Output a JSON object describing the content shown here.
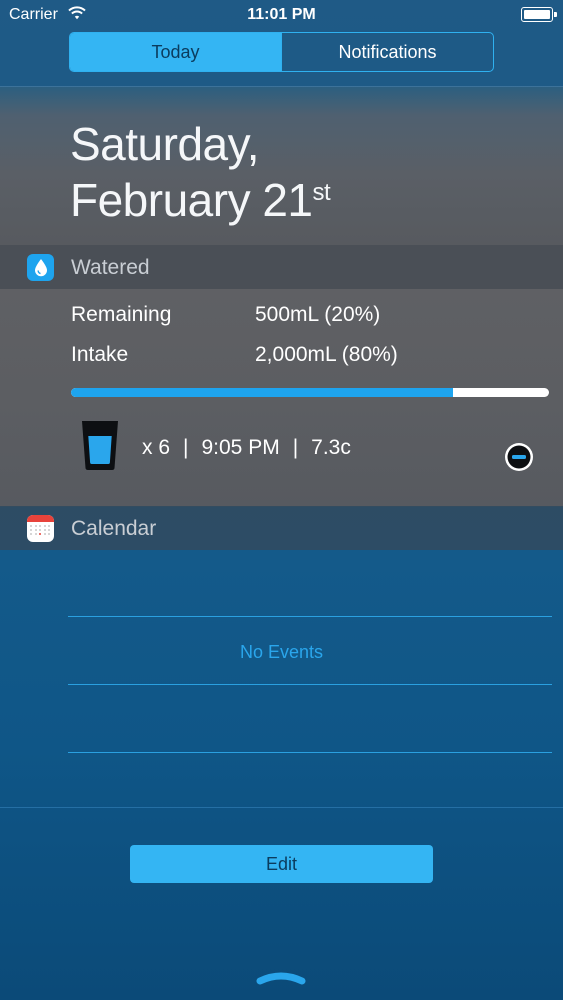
{
  "status_bar": {
    "carrier": "Carrier",
    "time": "11:01 PM",
    "wifi_icon": "wifi-icon",
    "battery_level": 1.0
  },
  "segmented_control": {
    "today_label": "Today",
    "notifications_label": "Notifications",
    "selected": "Today"
  },
  "date": {
    "line1": "Saturday,",
    "line2": "February 21",
    "suffix": "st"
  },
  "watered_widget": {
    "title": "Watered",
    "icon": "water-drop-icon",
    "remaining_label": "Remaining",
    "remaining_value": "500mL (20%)",
    "intake_label": "Intake",
    "intake_value": "2,000mL (80%)",
    "progress_fraction": 0.8,
    "log": {
      "count": "x 6",
      "sep1": "|",
      "time": "9:05 PM",
      "sep2": "|",
      "temp": "7.3c"
    }
  },
  "calendar_widget": {
    "title": "Calendar",
    "icon": "calendar-icon",
    "empty_text": "No Events"
  },
  "footer": {
    "edit_label": "Edit"
  },
  "colors": {
    "accent": "#34b5f3",
    "progress_fill": "#1ea4ee",
    "calendar_red": "#e8433b"
  }
}
